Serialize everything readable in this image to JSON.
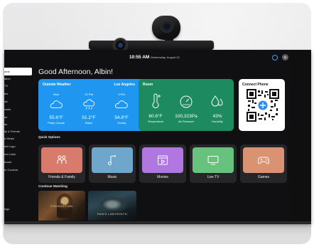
{
  "status": {
    "time": "10:55 AM",
    "date": "Wednesday, August 22",
    "avatar_initial": "N"
  },
  "sidebar": {
    "items": [
      {
        "label": "ome",
        "active": true
      },
      {
        "label": "ation"
      },
      {
        "label": "TV"
      },
      {
        "label": "ies"
      },
      {
        "label": "sic"
      },
      {
        "label": "casts"
      },
      {
        "label": "es"
      },
      {
        "label": "ds"
      },
      {
        "label": "ily & Friends"
      },
      {
        "label": "e Meals"
      },
      {
        "label": "ent Logo"
      },
      {
        "label": "ent Links"
      },
      {
        "label": "board"
      },
      {
        "label": "m Controls"
      },
      {
        "label": "ings"
      }
    ]
  },
  "greeting": "Good Afternoon, Albin!",
  "weather": {
    "title": "Outside Weather",
    "location": "Los Angeles",
    "columns": [
      {
        "time": "Now",
        "temp": "55.6°F",
        "desc": "Partly Clouds",
        "icon": "partly-cloudy-icon"
      },
      {
        "time": "12 PM",
        "temp": "51.2°F",
        "desc": "Rains",
        "icon": "rain-cloud-icon"
      },
      {
        "time": "3 PM",
        "temp": "54.8°F",
        "desc": "Cloudy",
        "icon": "cloud-icon"
      }
    ]
  },
  "room": {
    "title": "Room",
    "columns": [
      {
        "value": "60.6°F",
        "label": "Temperature",
        "icon": "thermometer-icon"
      },
      {
        "value": "100,323Pa",
        "label": "Air Pressure",
        "icon": "gauge-icon"
      },
      {
        "value": "43%",
        "label": "Humidity",
        "icon": "droplets-icon"
      }
    ]
  },
  "connect": {
    "title": "Connect Phone",
    "icon": "qr-code-icon"
  },
  "quick_options": {
    "title": "Quick Options",
    "items": [
      {
        "label": "Friends & Family",
        "color": "#d97b6c",
        "icon": "people-icon"
      },
      {
        "label": "Music",
        "color": "#6ea6cc",
        "icon": "music-note-icon"
      },
      {
        "label": "Movies",
        "color": "#b177e0",
        "icon": "movie-icon"
      },
      {
        "label": "Live TV",
        "color": "#67c27d",
        "icon": "tv-icon"
      },
      {
        "label": "Games",
        "color": "#d99272",
        "icon": "gamepad-icon"
      }
    ]
  },
  "continue": {
    "title": "Continue Watching",
    "items": [
      {
        "brand": "tv+",
        "title": "FOUNDATION"
      },
      {
        "title": "PAN'S LABYRINTH"
      }
    ]
  },
  "colors": {
    "weather": "#1f97f0",
    "room": "#1d8b5f",
    "screen": "#101012"
  }
}
